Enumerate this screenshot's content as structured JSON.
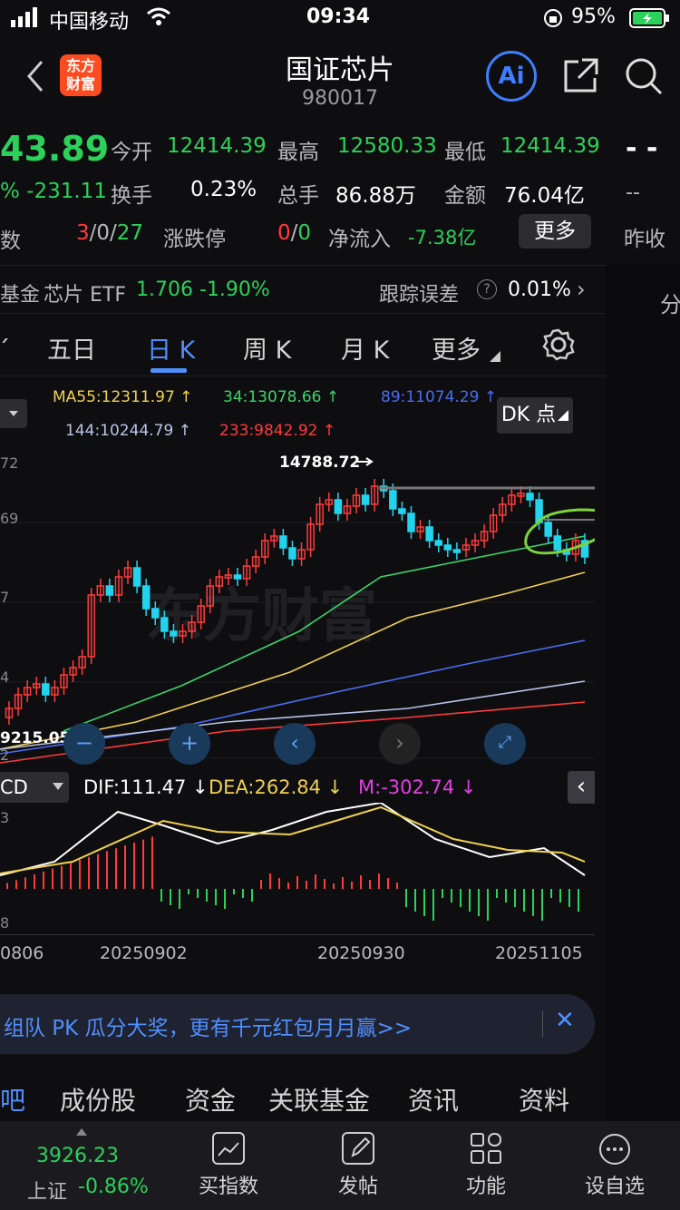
{
  "status_bar": {
    "carrier": "中国移动",
    "time": "09:34",
    "battery": "95%"
  },
  "header": {
    "title": "国证芯片",
    "code": "980017",
    "logo_text": "东方财富",
    "ai_label": "Ai"
  },
  "quote": {
    "price": "43.89",
    "change_line": "% -231.11",
    "counts_prefix": "数",
    "open_label": "今开",
    "open": "12414.39",
    "high_label": "最高",
    "high": "12580.33",
    "low_label": "最低",
    "low": "12414.39",
    "turnover_label": "换手",
    "turnover": "0.23%",
    "volume_label": "总手",
    "volume": "86.88万",
    "amount_label": "金额",
    "amount": "76.04亿",
    "adv_up": "3",
    "adv_flat": "0",
    "adv_down": "27",
    "limit_label": "涨跌停",
    "limit_up": "0",
    "limit_down": "0",
    "netflow_label": "净流入",
    "netflow": "-7.38亿",
    "more": "更多",
    "side_dash": "- -",
    "side_dash2": "--",
    "side_prev": "昨收",
    "side_fen": "分"
  },
  "etf": {
    "text1": "基金",
    "name": "芯片 ETF",
    "price": "1.706",
    "pct": "-1.90%",
    "track_label": "跟踪误差",
    "track_value": "0.01%"
  },
  "tabs": [
    "五日",
    "日 K",
    "周 K",
    "月 K",
    "更多"
  ],
  "ma": {
    "ma55": "MA55:12311.97 ↑",
    "ma34": "34:13078.66 ↑",
    "ma89": "89:11074.29 ↑",
    "ma144": "144:10244.79 ↑",
    "ma233": "233:9842.92 ↑"
  },
  "dk_button": "DK 点",
  "chart": {
    "high_marker": "14788.72",
    "low_marker": "9215.05",
    "axis_labels": [
      "72",
      "69",
      "7",
      "4",
      "2"
    ],
    "watermark": "东方财富"
  },
  "macd": {
    "name": "CD",
    "dif": "DIF:111.47 ↓",
    "dea": "DEA:262.84 ↓",
    "m": "M:-302.74 ↓",
    "axis_top": "3",
    "axis_bottom": "8"
  },
  "dates": [
    "0806",
    "20250902",
    "20250930",
    "20251105"
  ],
  "banner": {
    "text": "组队 PK 瓜分大奖，更有千元红包月月赢>>"
  },
  "bottom_tabs": [
    "吧",
    "成份股",
    "资金",
    "关联基金",
    "资讯",
    "资料"
  ],
  "dock": {
    "index_value": "3926.23",
    "index_name": "上证",
    "index_pct": "-0.86%",
    "items": [
      "买指数",
      "发帖",
      "功能",
      "设自选"
    ]
  },
  "colors": {
    "up": "#ff3b3b",
    "down": "#22d3ee",
    "green": "#2bd15a",
    "accent": "#4f8fff"
  }
}
